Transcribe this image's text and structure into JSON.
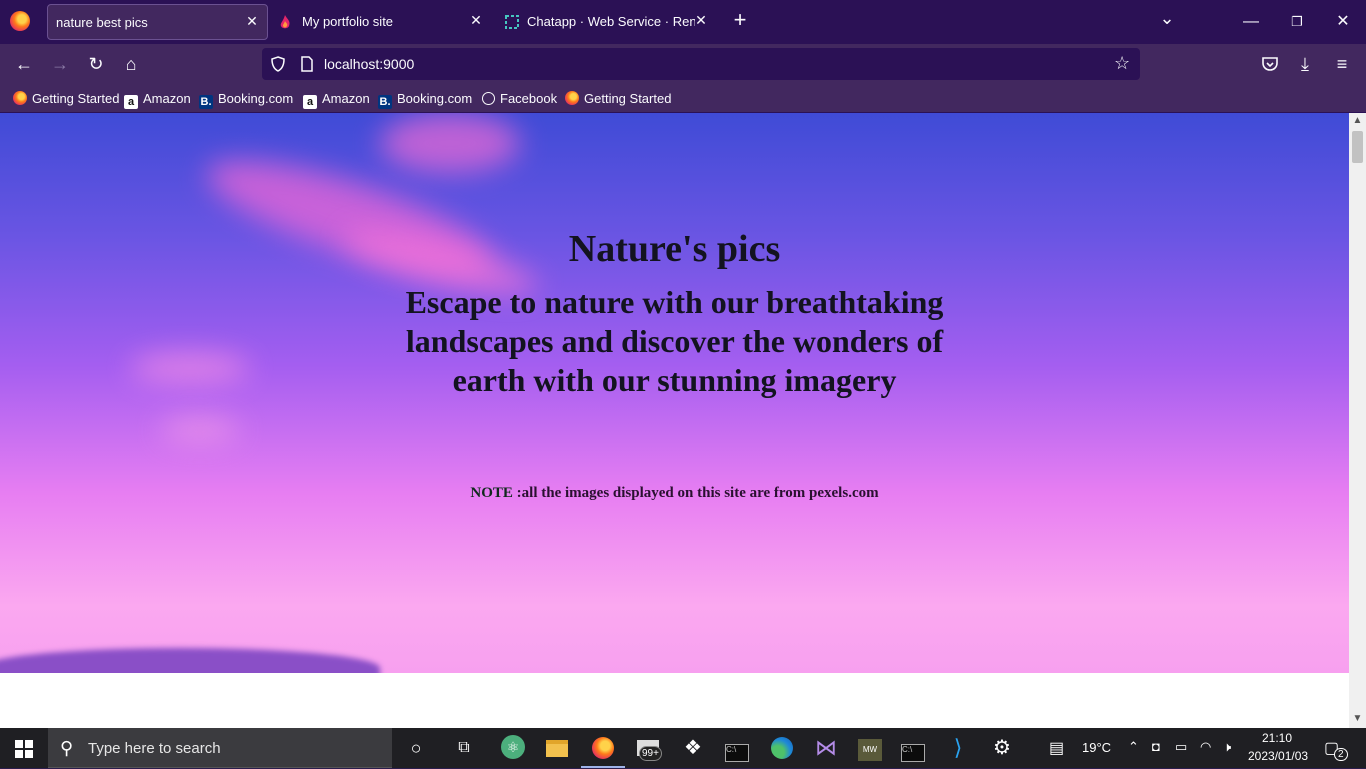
{
  "browser": {
    "tabs": [
      {
        "title": "nature best pics",
        "active": true
      },
      {
        "title": "My portfolio site",
        "active": false
      },
      {
        "title": "Chatapp · Web Service · Ren",
        "active": false
      }
    ],
    "new_tab_glyph": "+",
    "list_all_tabs_glyph": "⌄",
    "address": "localhost:9000",
    "bookmarks": [
      {
        "label": "Getting Started",
        "icon": "firefox-icon"
      },
      {
        "label": "Amazon",
        "icon": "amazon-icon"
      },
      {
        "label": "Booking.com",
        "icon": "booking-icon"
      },
      {
        "label": "Amazon",
        "icon": "amazon-icon"
      },
      {
        "label": "Booking.com",
        "icon": "booking-icon"
      },
      {
        "label": "Facebook",
        "icon": "globe-icon"
      },
      {
        "label": "Getting Started",
        "icon": "firefox-icon"
      }
    ]
  },
  "page": {
    "title": "Nature's pics",
    "subtitle": "Escape to nature with our breathtaking landscapes and discover the wonders of earth with our stunning imagery",
    "note_label": "NOTE",
    "note_text": ":all the images displayed on this site are from pexels.com"
  },
  "taskbar": {
    "search_placeholder": "Type here to search",
    "mail_badge": "99+",
    "weather": "19°C",
    "time": "21:10",
    "date": "2023/01/03",
    "notifications": "2"
  },
  "colors": {
    "browser_chrome": "#2b1155",
    "toolbar": "#42285f",
    "hero_top": "#3f4bd6",
    "hero_bottom": "#f7a0ef"
  }
}
